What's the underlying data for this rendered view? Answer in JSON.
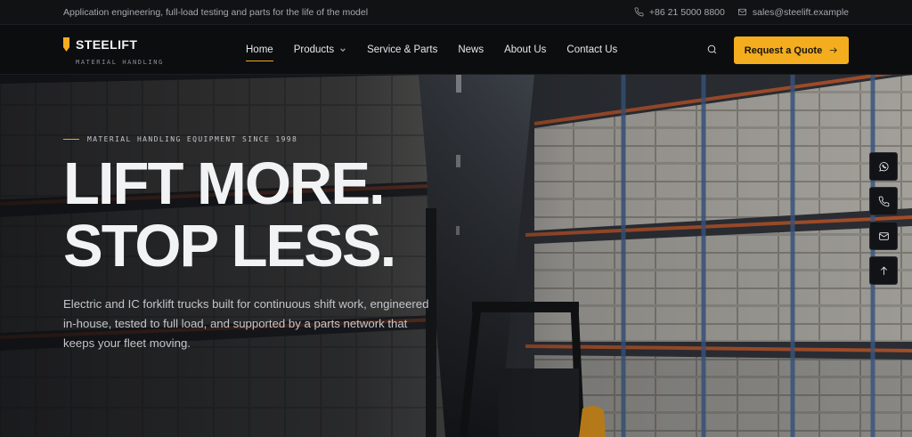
{
  "topbar": {
    "tagline": "Application engineering, full-load testing and parts for the life of the model",
    "phone": "+86 21 5000 8800",
    "email": "sales@steelift.example"
  },
  "brand": {
    "name": "STEELIFT",
    "tagline": "MATERIAL HANDLING",
    "accent_color": "#f3ad1e"
  },
  "nav": {
    "items": [
      {
        "label": "Home",
        "active": true
      },
      {
        "label": "Products",
        "has_dropdown": true
      },
      {
        "label": "Service & Parts"
      },
      {
        "label": "News"
      },
      {
        "label": "About Us"
      },
      {
        "label": "Contact Us"
      }
    ],
    "search_icon": "search-icon",
    "cta_label": "Request a Quote"
  },
  "hero": {
    "eyebrow": "MATERIAL HANDLING EQUIPMENT SINCE 1998",
    "headline_line1": "LIFT MORE.",
    "headline_line2": "STOP LESS.",
    "description": "Electric and IC forklift trucks built for continuous shift work, engineered in-house, tested to full load, and supported by a parts network that keeps your fleet moving."
  },
  "side_actions": [
    {
      "icon": "whatsapp-icon"
    },
    {
      "icon": "phone-icon"
    },
    {
      "icon": "mail-icon"
    },
    {
      "icon": "arrow-up-icon"
    }
  ]
}
